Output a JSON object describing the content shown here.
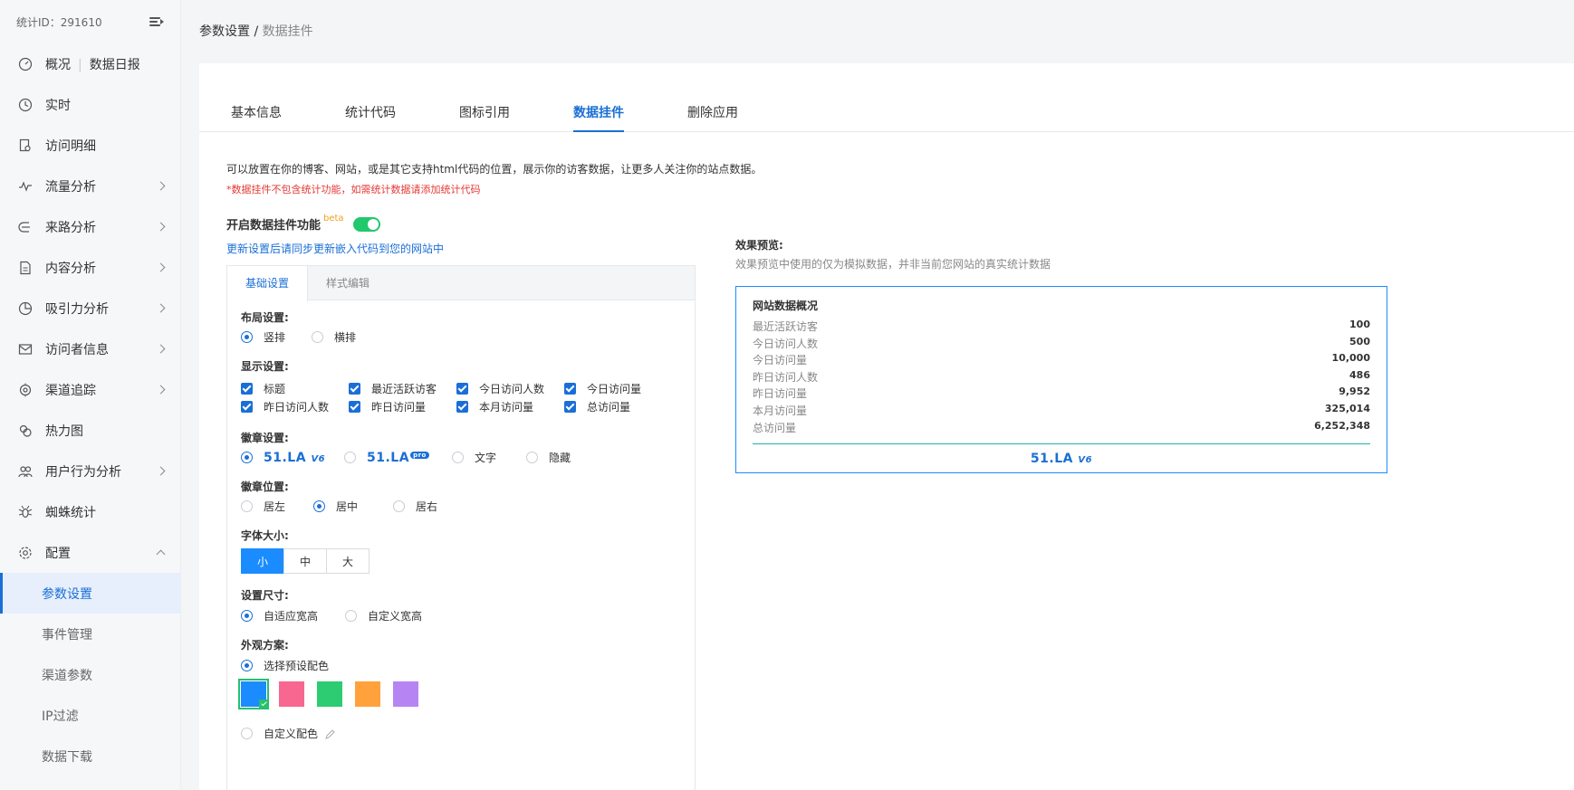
{
  "sidebar": {
    "stat_id": "统计ID：291610",
    "items": [
      {
        "label": "概况",
        "extra": "数据日报",
        "icon": "dashboard-icon"
      },
      {
        "label": "实时",
        "icon": "clock-icon"
      },
      {
        "label": "访问明细",
        "icon": "document-search-icon"
      },
      {
        "label": "流量分析",
        "icon": "pulse-icon"
      },
      {
        "label": "来路分析",
        "icon": "source-icon"
      },
      {
        "label": "内容分析",
        "icon": "file-icon"
      },
      {
        "label": "吸引力分析",
        "icon": "pie-icon"
      },
      {
        "label": "访问者信息",
        "icon": "mail-icon"
      },
      {
        "label": "渠道追踪",
        "icon": "target-icon"
      },
      {
        "label": "热力图",
        "icon": "heatmap-icon"
      },
      {
        "label": "用户行为分析",
        "icon": "users-icon"
      },
      {
        "label": "蜘蛛统计",
        "icon": "spider-icon"
      },
      {
        "label": "配置",
        "icon": "gear-icon"
      }
    ],
    "sub_items": [
      "参数设置",
      "事件管理",
      "渠道参数",
      "IP过滤",
      "数据下载"
    ]
  },
  "breadcrumb": {
    "parent": "参数设置",
    "separator": " / ",
    "current": "数据挂件"
  },
  "tabs": [
    "基本信息",
    "统计代码",
    "图标引用",
    "数据挂件",
    "删除应用"
  ],
  "description": "可以放置在你的博客、网站，或是其它支持html代码的位置，展示你的访客数据，让更多人关注你的站点数据。",
  "warning": "*数据挂件不包含统计功能，如需统计数据请添加统计代码",
  "enable": {
    "label": "开启数据挂件功能",
    "beta": "beta",
    "on": true
  },
  "update_link": "更新设置后请同步更新嵌入代码到您的网站中",
  "panel": {
    "tabs": [
      "基础设置",
      "样式编辑"
    ],
    "layout": {
      "title": "布局设置:",
      "options": [
        "竖排",
        "横排"
      ]
    },
    "display": {
      "title": "显示设置:",
      "options": [
        "标题",
        "最近活跃访客",
        "今日访问人数",
        "今日访问量",
        "昨日访问人数",
        "昨日访问量",
        "本月访问量",
        "总访问量"
      ]
    },
    "badge": {
      "title": "徽章设置:",
      "logo_text": "51.LA",
      "v6": "V6",
      "pro": "pro",
      "text_option": "文字",
      "hide_option": "隐藏"
    },
    "badge_pos": {
      "title": "徽章位置:",
      "options": [
        "居左",
        "居中",
        "居右"
      ]
    },
    "font_size": {
      "title": "字体大小:",
      "options": [
        "小",
        "中",
        "大"
      ]
    },
    "size": {
      "title": "设置尺寸:",
      "options": [
        "自适应宽高",
        "自定义宽高"
      ]
    },
    "appearance": {
      "title": "外观方案:",
      "preset": "选择预设配色",
      "custom": "自定义配色",
      "colors": [
        "#1a8cff",
        "#f7678f",
        "#2dcc72",
        "#ffa23b",
        "#b785f3"
      ]
    }
  },
  "preview": {
    "title": "效果预览:",
    "subtitle": "效果预览中使用的仅为模拟数据，并非当前您网站的真实统计数据",
    "box_title": "网站数据概况",
    "rows": [
      {
        "label": "最近活跃访客",
        "value": "100"
      },
      {
        "label": "今日访问人数",
        "value": "500"
      },
      {
        "label": "今日访问量",
        "value": "10,000"
      },
      {
        "label": "昨日访问人数",
        "value": "486"
      },
      {
        "label": "昨日访问量",
        "value": "9,952"
      },
      {
        "label": "本月访问量",
        "value": "325,014"
      },
      {
        "label": "总访问量",
        "value": "6,252,348"
      }
    ]
  },
  "colors": {
    "accent": "#1a6fd6",
    "switch_on": "#21c86c",
    "warning": "#e53935"
  }
}
